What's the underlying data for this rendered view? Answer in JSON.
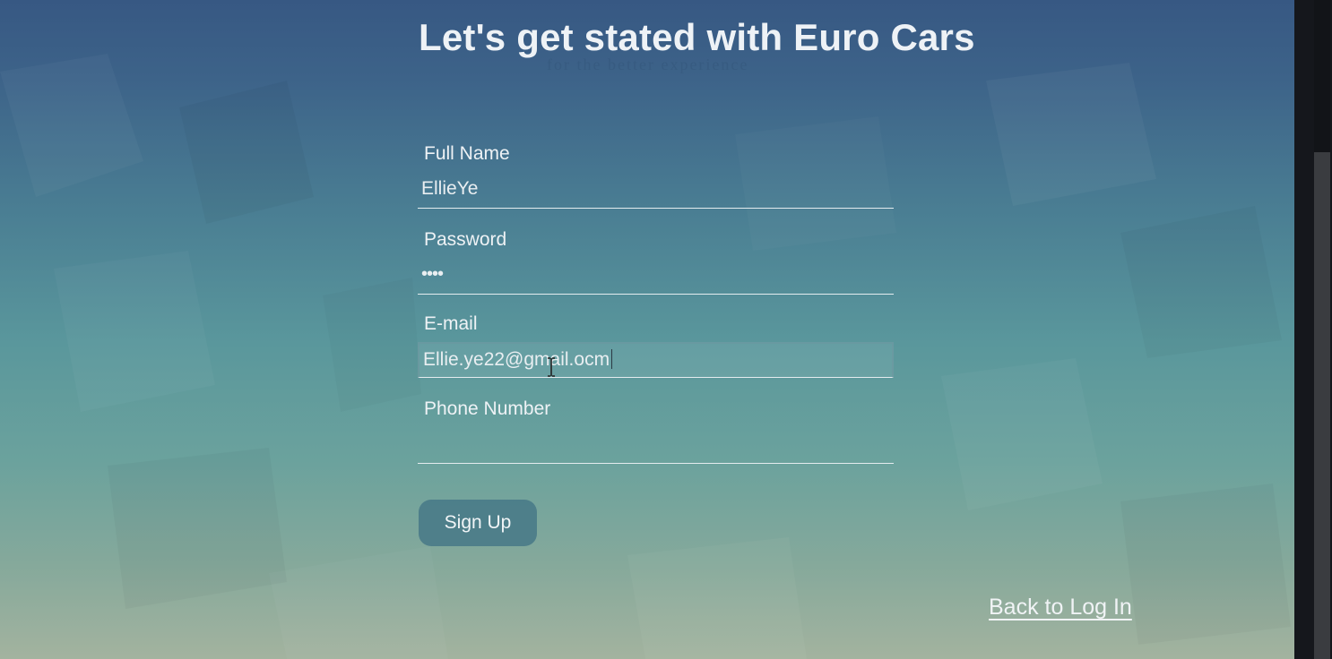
{
  "page": {
    "title": "Let's get stated with Euro Cars",
    "ghost_subtitle": "for the better experience"
  },
  "form": {
    "fields": [
      {
        "label": "Full Name",
        "value": "EllieYe"
      },
      {
        "label": "Password",
        "value": "••••"
      },
      {
        "label": "E-mail",
        "value": "Ellie.ye22@gmail.ocm"
      },
      {
        "label": "Phone Number",
        "value": ""
      }
    ],
    "submit_label": "Sign Up"
  },
  "footer": {
    "back_link": "Back to Log In"
  },
  "colors": {
    "background_top": "#375883",
    "background_bottom": "#a3b39f",
    "button": "#467887",
    "scrollbar": "#15171c"
  }
}
